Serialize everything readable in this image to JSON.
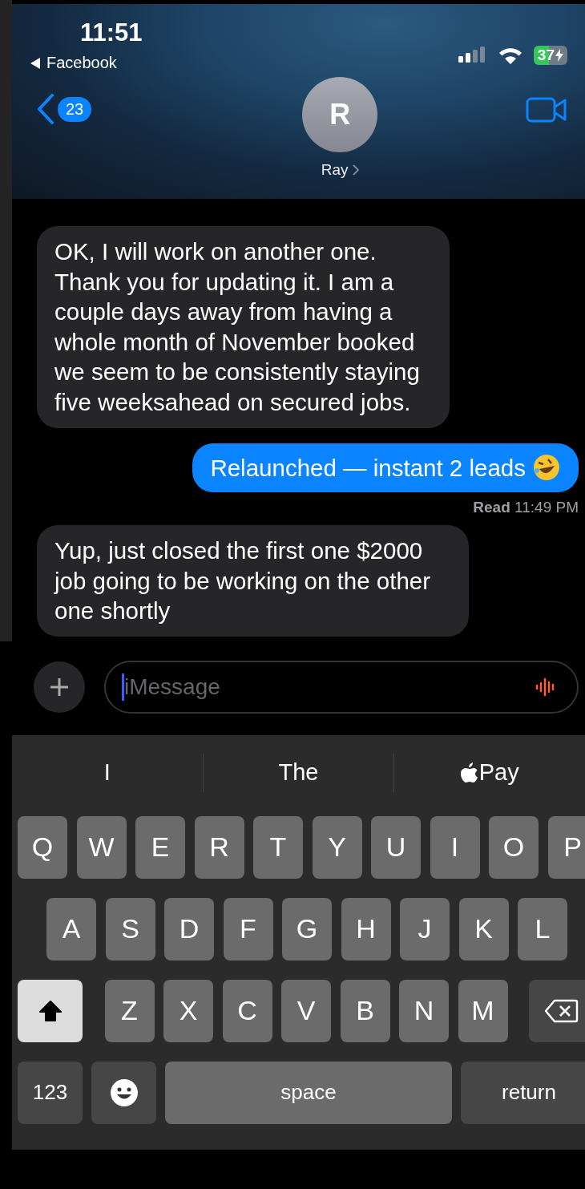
{
  "status_bar": {
    "time": "11:51",
    "back_app": "Facebook",
    "battery": "37"
  },
  "header": {
    "back_count": "23",
    "avatar_initial": "R",
    "contact_name": "Ray"
  },
  "messages": [
    {
      "kind": "received",
      "text": "OK, I will work on another one. Thank you for updating it. I am a couple days away from having a whole month of November booked we seem to be consistently staying five weeksahead on secured jobs."
    },
    {
      "kind": "sent",
      "text": "Relaunched — instant 2 leads",
      "emoji": {
        "kind": "laughing"
      }
    },
    {
      "kind": "receipt",
      "text": "**Read** 11:49 PM"
    },
    {
      "kind": "received",
      "text": "Yup, just closed the first one $2000 job going to be working on the other one shortly"
    }
  ],
  "composer": {
    "placeholder": "iMessage"
  },
  "keyboard": {
    "suggestions": [
      {
        "kind": "word",
        "text": "I"
      },
      {
        "kind": "word",
        "text": "The"
      },
      {
        "kind": "apple_pay",
        "text": "Pay"
      }
    ],
    "rows": [
      {
        "keys": [
          {
            "kind": "letter",
            "label": "Q"
          },
          {
            "kind": "letter",
            "label": "W"
          },
          {
            "kind": "letter",
            "label": "E"
          },
          {
            "kind": "letter",
            "label": "R"
          },
          {
            "kind": "letter",
            "label": "T"
          },
          {
            "kind": "letter",
            "label": "Y"
          },
          {
            "kind": "letter",
            "label": "U"
          },
          {
            "kind": "letter",
            "label": "I"
          },
          {
            "kind": "letter",
            "label": "O"
          },
          {
            "kind": "letter",
            "label": "P"
          }
        ]
      },
      {
        "keys": [
          {
            "kind": "letter",
            "label": "A"
          },
          {
            "kind": "letter",
            "label": "S"
          },
          {
            "kind": "letter",
            "label": "D"
          },
          {
            "kind": "letter",
            "label": "F"
          },
          {
            "kind": "letter",
            "label": "G"
          },
          {
            "kind": "letter",
            "label": "H"
          },
          {
            "kind": "letter",
            "label": "J"
          },
          {
            "kind": "letter",
            "label": "K"
          },
          {
            "kind": "letter",
            "label": "L"
          }
        ]
      },
      {
        "keys": [
          {
            "kind": "shift",
            "on": true
          },
          {
            "kind": "letter",
            "label": "Z"
          },
          {
            "kind": "letter",
            "label": "X"
          },
          {
            "kind": "letter",
            "label": "C"
          },
          {
            "kind": "letter",
            "label": "V"
          },
          {
            "kind": "letter",
            "label": "B"
          },
          {
            "kind": "letter",
            "label": "N"
          },
          {
            "kind": "letter",
            "label": "M"
          },
          {
            "kind": "backspace"
          }
        ]
      },
      {
        "keys": [
          {
            "kind": "numbers",
            "label": "123"
          },
          {
            "kind": "emoji"
          },
          {
            "kind": "space",
            "label": "space"
          },
          {
            "kind": "return",
            "label": "return"
          }
        ]
      }
    ]
  }
}
